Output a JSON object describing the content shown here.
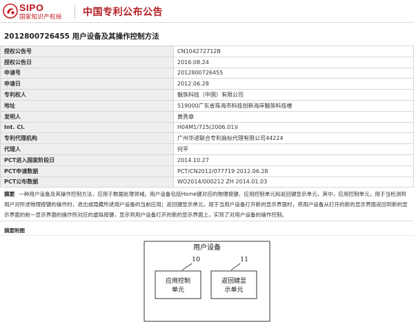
{
  "header": {
    "logo_sipo": "SIPO",
    "logo_org": "国家知识产权局",
    "title": "中国专利公布公告"
  },
  "publication": {
    "title": "2012800726455  用户设备及其操作控制方法"
  },
  "info_rows": [
    {
      "label": "授权公告号",
      "value": "CN104272712B"
    },
    {
      "label": "授权公告日",
      "value": "2016.08.24"
    },
    {
      "label": "申请号",
      "value": "2012800726455"
    },
    {
      "label": "申请日",
      "value": "2012.06.28"
    },
    {
      "label": "专利权人",
      "value": "魅族科技（中国）有限公司"
    },
    {
      "label": "地址",
      "value": "519000广东省珠海市科技创新海岸魅族科技楼"
    },
    {
      "label": "发明人",
      "value": "黄秀章"
    },
    {
      "label": "Int. Cl.",
      "value": "H04M1/725(2006.01)I"
    },
    {
      "label": "专利代理机构",
      "value": "广州华进联合专利商标代理有限公司44224"
    },
    {
      "label": "代理人",
      "value": "何平"
    },
    {
      "label": "PCT进入国家阶段日",
      "value": "2014.10.27"
    },
    {
      "label": "PCT申请数据",
      "value": "PCT/CN2012/077719 2012.06.28"
    },
    {
      "label": "PCT公布数据",
      "value": "WO2014/000212 ZH 2014.01.03"
    }
  ],
  "abstract": {
    "label": "摘要",
    "text": "一种用户设备及其操作控制方法，应用于数据处理领域。用户设备包括Home键对应的物理按键、应用控制单元和返回键显示单元，其中，应用控制单元，用于当检测到用户对所述物理按键的操作时，退出或隐藏所述用户设备的当前应用；返回键显示单元，用于当用户设备打开新的显示界面时，将用户设备从打开的新的显示界面返回到新的显示界面的前一显示界面的操作所对应的虚拟按键，显示到用户设备打开的新的显示界面上，实现了对用户设备的操作控制。"
  },
  "figure": {
    "section_label": "摘要附图",
    "device_label": "用户设备",
    "box1_number": "10",
    "box1_line1": "应用控制",
    "box1_line2": "单元",
    "box2_number": "11",
    "box2_line1": "返回键显",
    "box2_line2": "示单元"
  },
  "colors": {
    "brand_red": "#c4161c",
    "label_bg": "#eeeeee",
    "border": "#d6d6d6"
  }
}
